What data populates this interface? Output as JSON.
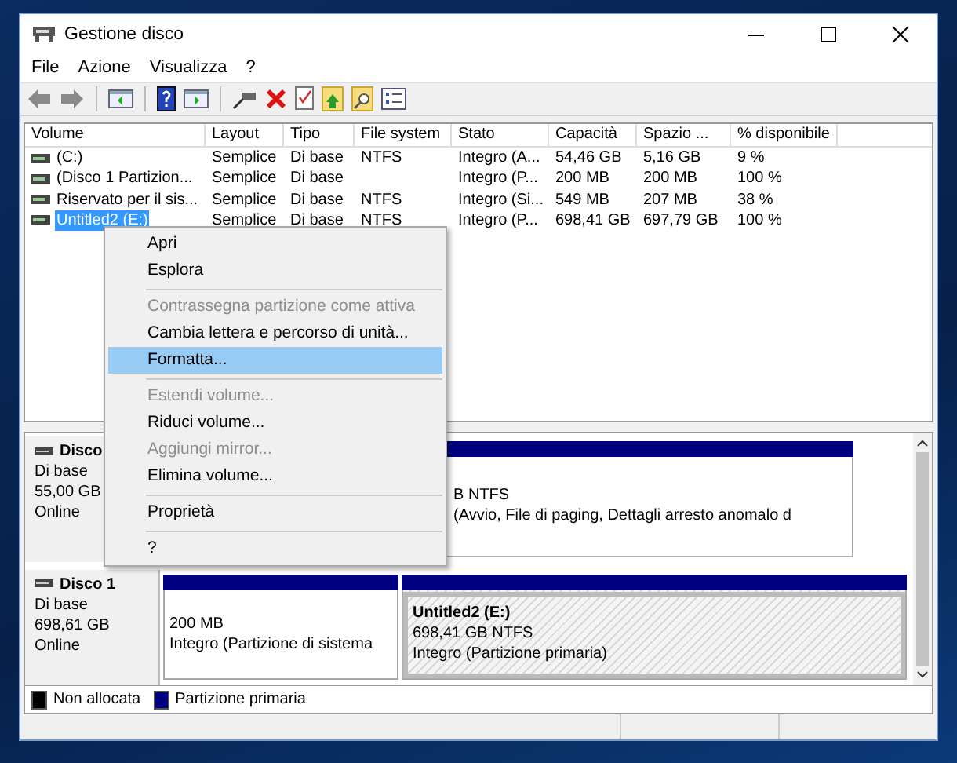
{
  "window": {
    "title": "Gestione disco"
  },
  "menu": [
    "File",
    "Azione",
    "Visualizza",
    "?"
  ],
  "table": {
    "columns": [
      "Volume",
      "Layout",
      "Tipo",
      "File system",
      "Stato",
      "Capacità",
      "Spazio ...",
      "% disponibile"
    ],
    "rows": [
      {
        "cells": [
          "(C:)",
          "Semplice",
          "Di base",
          "NTFS",
          "Integro (A...",
          "54,46 GB",
          "5,16 GB",
          "9 %"
        ],
        "selected": false
      },
      {
        "cells": [
          "(Disco 1 Partizion...",
          "Semplice",
          "Di base",
          "",
          "Integro (P...",
          "200 MB",
          "200 MB",
          "100 %"
        ],
        "selected": false
      },
      {
        "cells": [
          "Riservato per il sis...",
          "Semplice",
          "Di base",
          "NTFS",
          "Integro (Si...",
          "549 MB",
          "207 MB",
          "38 %"
        ],
        "selected": false
      },
      {
        "cells": [
          "Untitled2 (E:)",
          "Semplice",
          "Di base",
          "NTFS",
          "Integro (P...",
          "698,41 GB",
          "697,79 GB",
          "100 %"
        ],
        "selected": true
      }
    ]
  },
  "disks": [
    {
      "name": "Disco",
      "type": "Di base",
      "size": "55,00 GB",
      "status": "Online",
      "partitions": [
        {
          "lines": [
            "B NTFS",
            "(Avvio, File di paging, Dettagli arresto anomalo d"
          ],
          "selected": false
        }
      ]
    },
    {
      "name": "Disco 1",
      "type": "Di base",
      "size": "698,61 GB",
      "status": "Online",
      "partitions": [
        {
          "lines": [
            "200 MB",
            "Integro (Partizione di sistema"
          ],
          "selected": false
        },
        {
          "title": "Untitled2  (E:)",
          "lines": [
            "698,41 GB NTFS",
            "Integro (Partizione primaria)"
          ],
          "selected": true
        }
      ]
    }
  ],
  "legend": [
    {
      "label": "Non allocata",
      "color": "#000000"
    },
    {
      "label": "Partizione primaria",
      "color": "#000080"
    }
  ],
  "context_menu": [
    {
      "kind": "item",
      "label": "Apri",
      "disabled": false,
      "selected": false
    },
    {
      "kind": "item",
      "label": "Esplora",
      "disabled": false,
      "selected": false
    },
    {
      "kind": "separator"
    },
    {
      "kind": "item",
      "label": "Contrassegna partizione come attiva",
      "disabled": true,
      "selected": false
    },
    {
      "kind": "item",
      "label": "Cambia lettera e percorso di unità...",
      "disabled": false,
      "selected": false
    },
    {
      "kind": "item",
      "label": "Formatta...",
      "disabled": false,
      "selected": true
    },
    {
      "kind": "separator"
    },
    {
      "kind": "item",
      "label": "Estendi volume...",
      "disabled": true,
      "selected": false
    },
    {
      "kind": "item",
      "label": "Riduci volume...",
      "disabled": false,
      "selected": false
    },
    {
      "kind": "item",
      "label": "Aggiungi mirror...",
      "disabled": true,
      "selected": false
    },
    {
      "kind": "item",
      "label": "Elimina volume...",
      "disabled": false,
      "selected": false
    },
    {
      "kind": "separator"
    },
    {
      "kind": "item",
      "label": "Proprietà",
      "disabled": false,
      "selected": false
    },
    {
      "kind": "separator"
    },
    {
      "kind": "item",
      "label": "?",
      "disabled": false,
      "selected": false
    }
  ]
}
